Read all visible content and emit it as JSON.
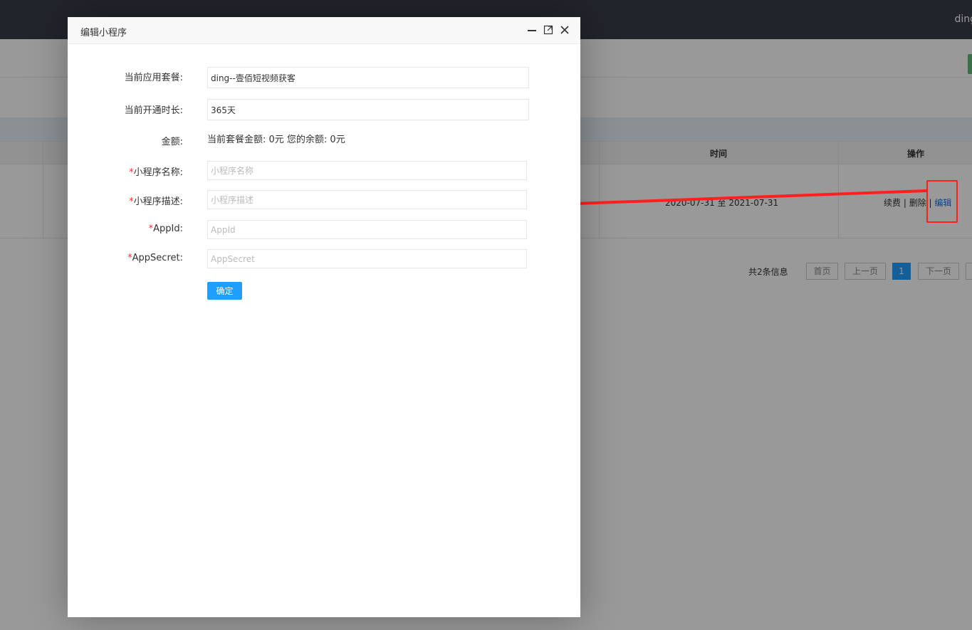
{
  "background": {
    "user_name": "ding",
    "table": {
      "col_time_header": "时间",
      "col_ops_header": "操作",
      "row_time": "2020-07-31 至 2021-07-31",
      "op_renew": "续费",
      "op_sep1": " | ",
      "op_delete": "删除",
      "op_sep2": " | ",
      "op_edit": "编辑"
    },
    "pager": {
      "total": "共2条信息",
      "first": "首页",
      "prev": "上一页",
      "current": "1",
      "next": "下一页"
    }
  },
  "modal": {
    "title": "编辑小程序",
    "controls": {
      "minimize_icon": "minimize-icon",
      "maximize_icon": "maximize-icon",
      "close_icon": "close-icon"
    },
    "fields": {
      "package_label": "当前应用套餐:",
      "package_value": "ding--壹佰短视频获客",
      "duration_label": "当前开通时长:",
      "duration_value": "365天",
      "amount_label": "金额:",
      "amount_text": "当前套餐金额: 0元 您的余额: 0元",
      "name_req": "*",
      "name_label": "小程序名称:",
      "name_placeholder": "小程序名称",
      "desc_req": "*",
      "desc_label": "小程序描述:",
      "desc_placeholder": "小程序描述",
      "appid_req": "*",
      "appid_label": "AppId:",
      "appid_placeholder": "AppId",
      "secret_req": "*",
      "secret_label": "AppSecret:",
      "secret_placeholder": "AppSecret"
    },
    "confirm_label": "确定"
  },
  "colors": {
    "annotation_red": "#ff1f1f",
    "primary_blue": "#1e9fff",
    "topbar": "#393d49"
  }
}
